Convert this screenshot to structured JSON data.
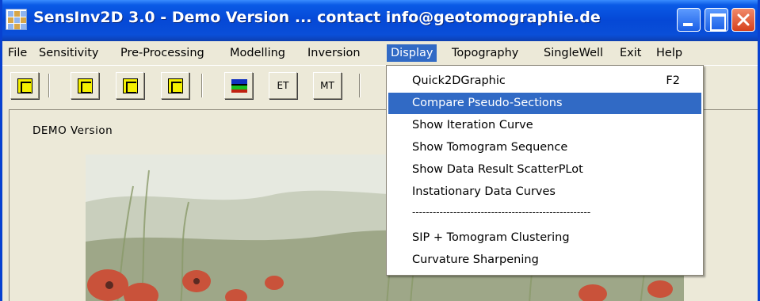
{
  "window": {
    "title": "SensInv2D 3.0 - Demo Version ... contact info@geotomographie.de",
    "icon": "grid-app-icon"
  },
  "menubar": {
    "items": [
      {
        "label": "File"
      },
      {
        "label": "Sensitivity"
      },
      {
        "label": "Pre-Processing"
      },
      {
        "label": "Modelling"
      },
      {
        "label": "Inversion"
      },
      {
        "label": "Display"
      },
      {
        "label": "Topography"
      },
      {
        "label": "SingleWell"
      },
      {
        "label": "Exit"
      },
      {
        "label": "Help"
      }
    ],
    "active": "Display"
  },
  "toolbar": {
    "buttons": [
      {
        "label": "",
        "icon": "sheet-icon"
      },
      {
        "label": "",
        "icon": "sen-icon"
      },
      {
        "label": "",
        "icon": "mg-icon"
      },
      {
        "label": "",
        "icon": "inv-icon"
      },
      {
        "label": "",
        "icon": "layers-icon"
      },
      {
        "label": "ET"
      },
      {
        "label": "MT"
      }
    ]
  },
  "client": {
    "demo_label": "DEMO Version"
  },
  "display_menu": {
    "items": [
      {
        "label": "Quick2DGraphic",
        "shortcut": "F2"
      },
      {
        "label": "Compare Pseudo-Sections",
        "highlighted": true
      },
      {
        "label": "Show Iteration Curve"
      },
      {
        "label": "Show Tomogram Sequence"
      },
      {
        "label": "Show Data Result ScatterPLot"
      },
      {
        "label": "Instationary Data Curves"
      },
      {
        "label": "----------------------------------------------------"
      },
      {
        "label": "SIP + Tomogram Clustering"
      },
      {
        "label": "Curvature Sharpening"
      }
    ]
  },
  "colors": {
    "titlebar": "#0548d6",
    "menu_highlight": "#316ac5",
    "face": "#ece9d8"
  }
}
